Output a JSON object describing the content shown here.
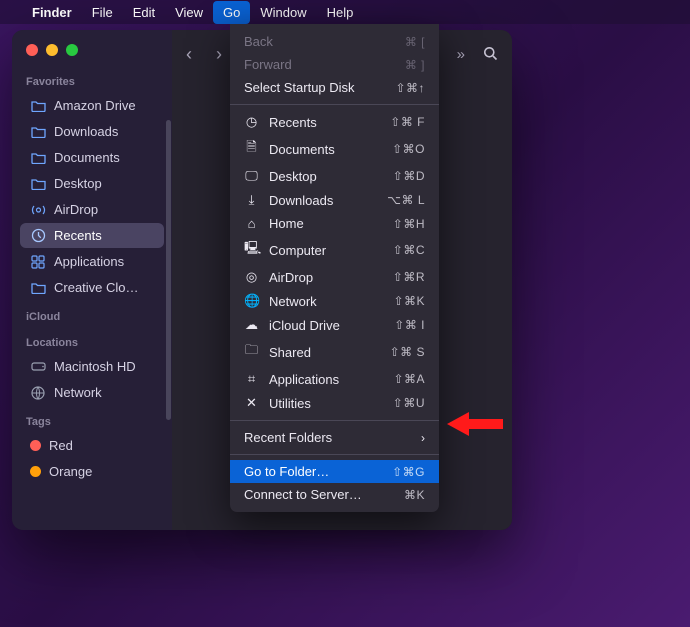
{
  "menubar": {
    "app": "Finder",
    "items": [
      "File",
      "Edit",
      "View",
      "Go",
      "Window",
      "Help"
    ],
    "open_index": 3
  },
  "sidebar": {
    "sections": [
      {
        "title": "Favorites",
        "items": [
          {
            "icon": "folder",
            "label": "Amazon Drive"
          },
          {
            "icon": "folder",
            "label": "Downloads"
          },
          {
            "icon": "folder",
            "label": "Documents"
          },
          {
            "icon": "folder",
            "label": "Desktop"
          },
          {
            "icon": "airdrop",
            "label": "AirDrop"
          },
          {
            "icon": "clock",
            "label": "Recents",
            "selected": true
          },
          {
            "icon": "grid",
            "label": "Applications"
          },
          {
            "icon": "folder",
            "label": "Creative Clo…"
          }
        ]
      },
      {
        "title": "iCloud",
        "items": []
      },
      {
        "title": "Locations",
        "items": [
          {
            "icon": "disk",
            "label": "Macintosh HD",
            "gray": true
          },
          {
            "icon": "globe",
            "label": "Network",
            "gray": true
          }
        ]
      },
      {
        "title": "Tags",
        "items": [
          {
            "icon": "tag-red",
            "label": "Red"
          },
          {
            "icon": "tag-orange",
            "label": "Orange"
          }
        ]
      }
    ]
  },
  "go_menu": {
    "groups": [
      [
        {
          "label": "Back",
          "shortcut": "⌘ [",
          "disabled": true
        },
        {
          "label": "Forward",
          "shortcut": "⌘ ]",
          "disabled": true
        },
        {
          "label": "Select Startup Disk",
          "shortcut": "⇧⌘↑"
        }
      ],
      [
        {
          "icon": "clock",
          "label": "Recents",
          "shortcut": "⇧⌘ F"
        },
        {
          "icon": "doc",
          "label": "Documents",
          "shortcut": "⇧⌘O"
        },
        {
          "icon": "desktop",
          "label": "Desktop",
          "shortcut": "⇧⌘D"
        },
        {
          "icon": "download",
          "label": "Downloads",
          "shortcut": "⌥⌘ L"
        },
        {
          "icon": "home",
          "label": "Home",
          "shortcut": "⇧⌘H"
        },
        {
          "icon": "computer",
          "label": "Computer",
          "shortcut": "⇧⌘C"
        },
        {
          "icon": "airdrop",
          "label": "AirDrop",
          "shortcut": "⇧⌘R"
        },
        {
          "icon": "globe",
          "label": "Network",
          "shortcut": "⇧⌘K"
        },
        {
          "icon": "cloud",
          "label": "iCloud Drive",
          "shortcut": "⇧⌘ I"
        },
        {
          "icon": "shared",
          "label": "Shared",
          "shortcut": "⇧⌘ S"
        },
        {
          "icon": "grid",
          "label": "Applications",
          "shortcut": "⇧⌘A"
        },
        {
          "icon": "wrench",
          "label": "Utilities",
          "shortcut": "⇧⌘U"
        }
      ],
      [
        {
          "label": "Recent Folders",
          "submenu": true
        }
      ],
      [
        {
          "label": "Go to Folder…",
          "shortcut": "⇧⌘G",
          "highlight": true
        },
        {
          "label": "Connect to Server…",
          "shortcut": "⌘K"
        }
      ]
    ]
  }
}
